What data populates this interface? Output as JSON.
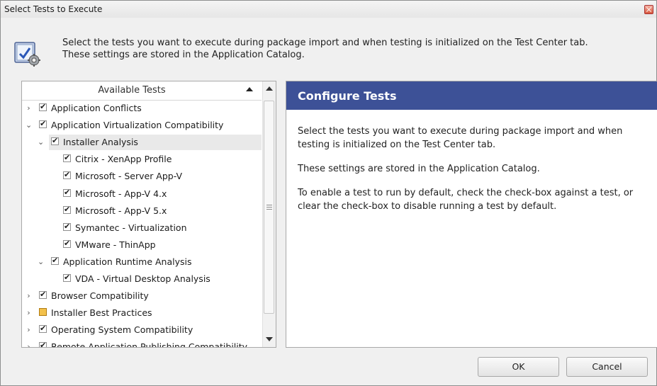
{
  "window": {
    "title": "Select Tests to Execute"
  },
  "description": {
    "line1": "Select the tests you want to execute during package import and when testing is initialized on the Test Center tab.",
    "line2": "These settings are stored in the Application Catalog."
  },
  "tree": {
    "header": "Available Tests",
    "items": [
      {
        "label": "Application Conflicts",
        "expander": "collapsed",
        "checked": true
      },
      {
        "label": "Application Virtualization Compatibility",
        "expander": "expanded",
        "checked": true
      },
      {
        "label": "Installer Analysis",
        "expander": "expanded",
        "checked": true,
        "selected": true
      },
      {
        "label": "Citrix - XenApp Profile",
        "checked": true
      },
      {
        "label": "Microsoft - Server App-V",
        "checked": true
      },
      {
        "label": "Microsoft - App-V 4.x",
        "checked": true
      },
      {
        "label": "Microsoft - App-V 5.x",
        "checked": true
      },
      {
        "label": "Symantec - Virtualization",
        "checked": true
      },
      {
        "label": "VMware - ThinApp",
        "checked": true
      },
      {
        "label": "Application Runtime Analysis",
        "expander": "expanded",
        "checked": true
      },
      {
        "label": "VDA - Virtual Desktop Analysis",
        "checked": true
      },
      {
        "label": "Browser Compatibility",
        "expander": "collapsed",
        "checked": true
      },
      {
        "label": "Installer Best Practices",
        "expander": "collapsed",
        "checked": "partial"
      },
      {
        "label": "Operating System Compatibility",
        "expander": "collapsed",
        "checked": true
      },
      {
        "label": "Remote Application Publishing Compatibility",
        "expander": "collapsed",
        "checked": true
      }
    ]
  },
  "configure": {
    "title": "Configure Tests",
    "p1": "Select the tests you want to execute during package import and when testing is initialized on the Test Center tab.",
    "p2": "These settings are stored in the Application Catalog.",
    "p3": "To enable a test to run by default, check the check-box against a test, or clear the check-box to disable running a test by default."
  },
  "buttons": {
    "ok": "OK",
    "cancel": "Cancel"
  },
  "colors": {
    "accent": "#3d5197",
    "partial_check": "#f3c14b"
  }
}
